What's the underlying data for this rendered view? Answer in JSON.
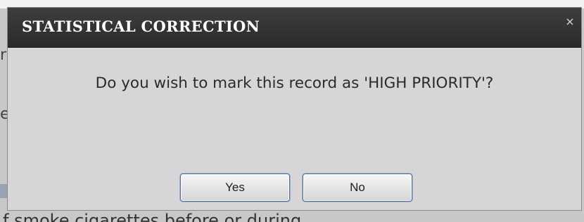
{
  "dialog": {
    "title": "STATISTICAL CORRECTION",
    "close_label": "×",
    "message": "Do you wish to mark this record as 'HIGH PRIORITY'?",
    "buttons": {
      "yes": "Yes",
      "no": "No"
    }
  },
  "background": {
    "left_glyphs": [
      "r",
      "e"
    ],
    "bottom_text": "f smoke cigarettes before or during"
  },
  "colors": {
    "titlebar": "#2f2f2f",
    "title_text": "#ffffff",
    "dialog_body": "#d7d5d8",
    "button_border": "#5a6e8c"
  }
}
